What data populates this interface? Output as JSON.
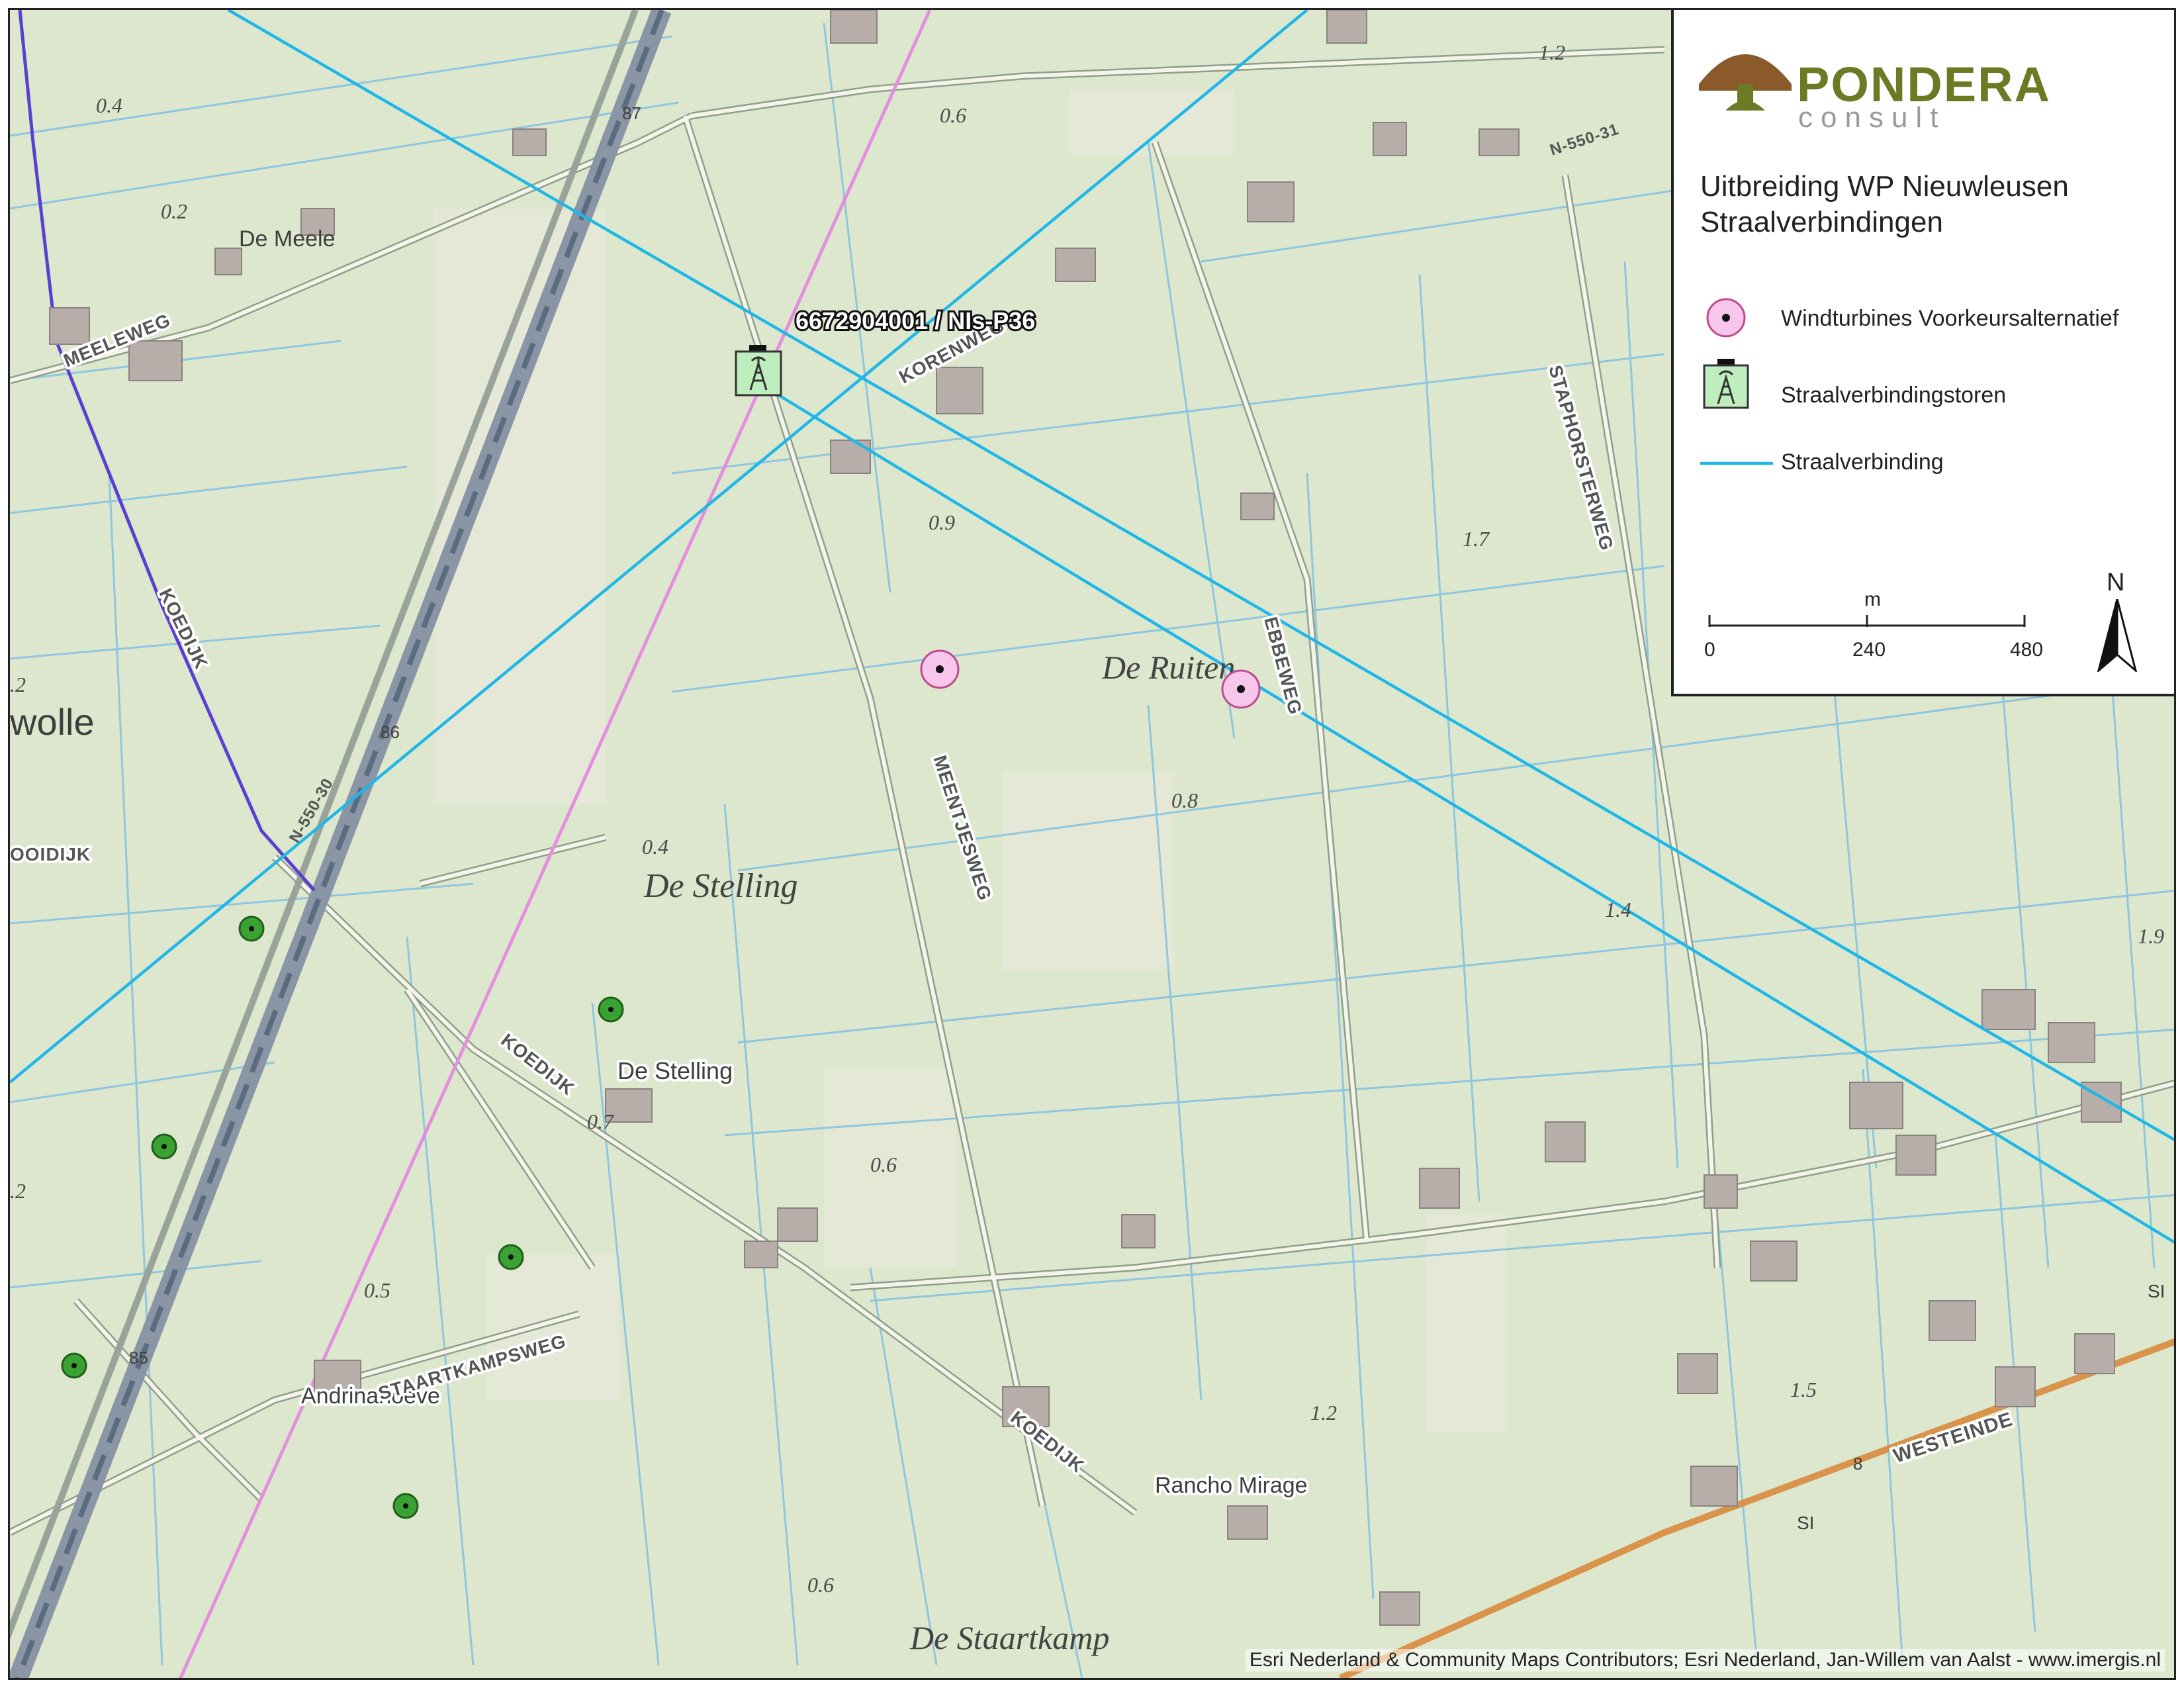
{
  "title": {
    "line1": "Uitbreiding WP Nieuwleusen",
    "line2": "Straalverbindingen"
  },
  "logo": {
    "name": "PONDERA",
    "sub": "consult"
  },
  "legend": {
    "items": [
      {
        "label": "Windturbines Voorkeursalternatief",
        "symbol": "pink-turbine"
      },
      {
        "label": "Straalverbindingstoren",
        "symbol": "tower-icon"
      },
      {
        "label": "Straalverbinding",
        "symbol": "cyan-line"
      }
    ]
  },
  "scale_bar": {
    "unit": "m",
    "ticks": [
      "0",
      "240",
      "480"
    ]
  },
  "north_arrow": "N",
  "tower_label": "6672904001 / NIs-P36",
  "attribution": "Esri Nederland & Community Maps Contributors; Esri Nederland, Jan-Willem van Aalst - www.imergis.nl",
  "colors": {
    "beam": "#1fb7e8",
    "turbine_pink": "#f6c7ea",
    "turbine_green": "#3aa232",
    "tower_fill": "#bfeebe",
    "railway_pink": "#e58ee0",
    "canal": "#7fbfe0",
    "boundary": "#5c3fd0",
    "logo_brown": "#8b5a2b",
    "logo_green": "#6d7a25"
  },
  "map": {
    "places": [
      "De Meele",
      "De Ruiten",
      "De Stelling",
      "De Stelling",
      "Andrinahoeve",
      "Rancho Mirage",
      "De Staartkamp",
      "wolle"
    ],
    "roads": [
      "MEELEWEG",
      "KOEDIJK",
      "KOEDIJK",
      "KOEDIJK",
      "KORENWEG",
      "STAPHORSTERWEG",
      "EBBEWEG",
      "MEENTJESWEG",
      "STAARTKAMPSWEG",
      "WESTEINDE",
      "N-550-30",
      "N-550-31",
      "OOIDIJK"
    ],
    "elevations": [
      "0.4",
      "0.2",
      "0.6",
      "0.9",
      "1.2",
      "1.7",
      "1.4",
      "1.9",
      "0.8",
      "0.4",
      "0.7",
      "0.6",
      "0.5",
      "1.2",
      "1.5",
      "0.6",
      ".2",
      ".2"
    ],
    "misc_labels": [
      "87",
      "86",
      "85",
      "8",
      "SI",
      "SI"
    ]
  }
}
